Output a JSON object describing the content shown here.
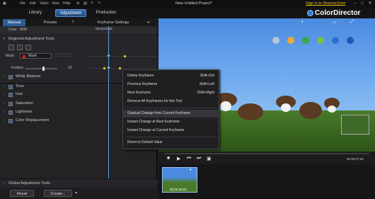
{
  "menubar": {
    "items": [
      "File",
      "Edit",
      "Video",
      "View",
      "Help"
    ],
    "title": "New Untitled Project*",
    "signin": "Sign in to DirectorZone"
  },
  "modes": [
    "Library",
    "Adjustment",
    "Production"
  ],
  "brand": "ColorDirector",
  "subtabs": [
    "Manual",
    "Presets",
    "Keyframe Settings"
  ],
  "color_label": "Color : 85M",
  "timecode_top": "00;00;02;25",
  "regional": {
    "title": "Regional Adjustment Tools",
    "mask_label": "Mask",
    "mask_value": "Mask",
    "feather_label": "Feather",
    "feather_value": "12"
  },
  "sections": [
    "White Balance",
    "Tone",
    "Hue",
    "Saturation",
    "Lightness",
    "Color Replacement"
  ],
  "global_tools": "Global Adjustment Tools",
  "buttons": {
    "reset": "Reset",
    "create": "Create..."
  },
  "context_menu": [
    {
      "label": "Delete Keyframe",
      "shortcut": "Shift+Del"
    },
    {
      "label": "Previous Keyframe",
      "shortcut": "Shift+Left"
    },
    {
      "label": "Next Keyframe",
      "shortcut": "Shift+Right"
    },
    {
      "label": "Remove All Keyframes for this Tool",
      "shortcut": ""
    },
    {
      "label": "Gradual Change from Current Keyframe",
      "shortcut": ""
    },
    {
      "label": "Instant Change at Next Keyframe",
      "shortcut": ""
    },
    {
      "label": "Instant Change at Current Keyframe",
      "shortcut": ""
    },
    {
      "label": "Reset to Default Value",
      "shortcut": ""
    }
  ],
  "preview_timecode": "00;00;07;02",
  "clip_time": "00;00;20;02",
  "swatches": [
    "#b7c3d6",
    "#f0a834",
    "#3aa84a",
    "#74c241",
    "#2e6fd0",
    "#2554b8"
  ]
}
